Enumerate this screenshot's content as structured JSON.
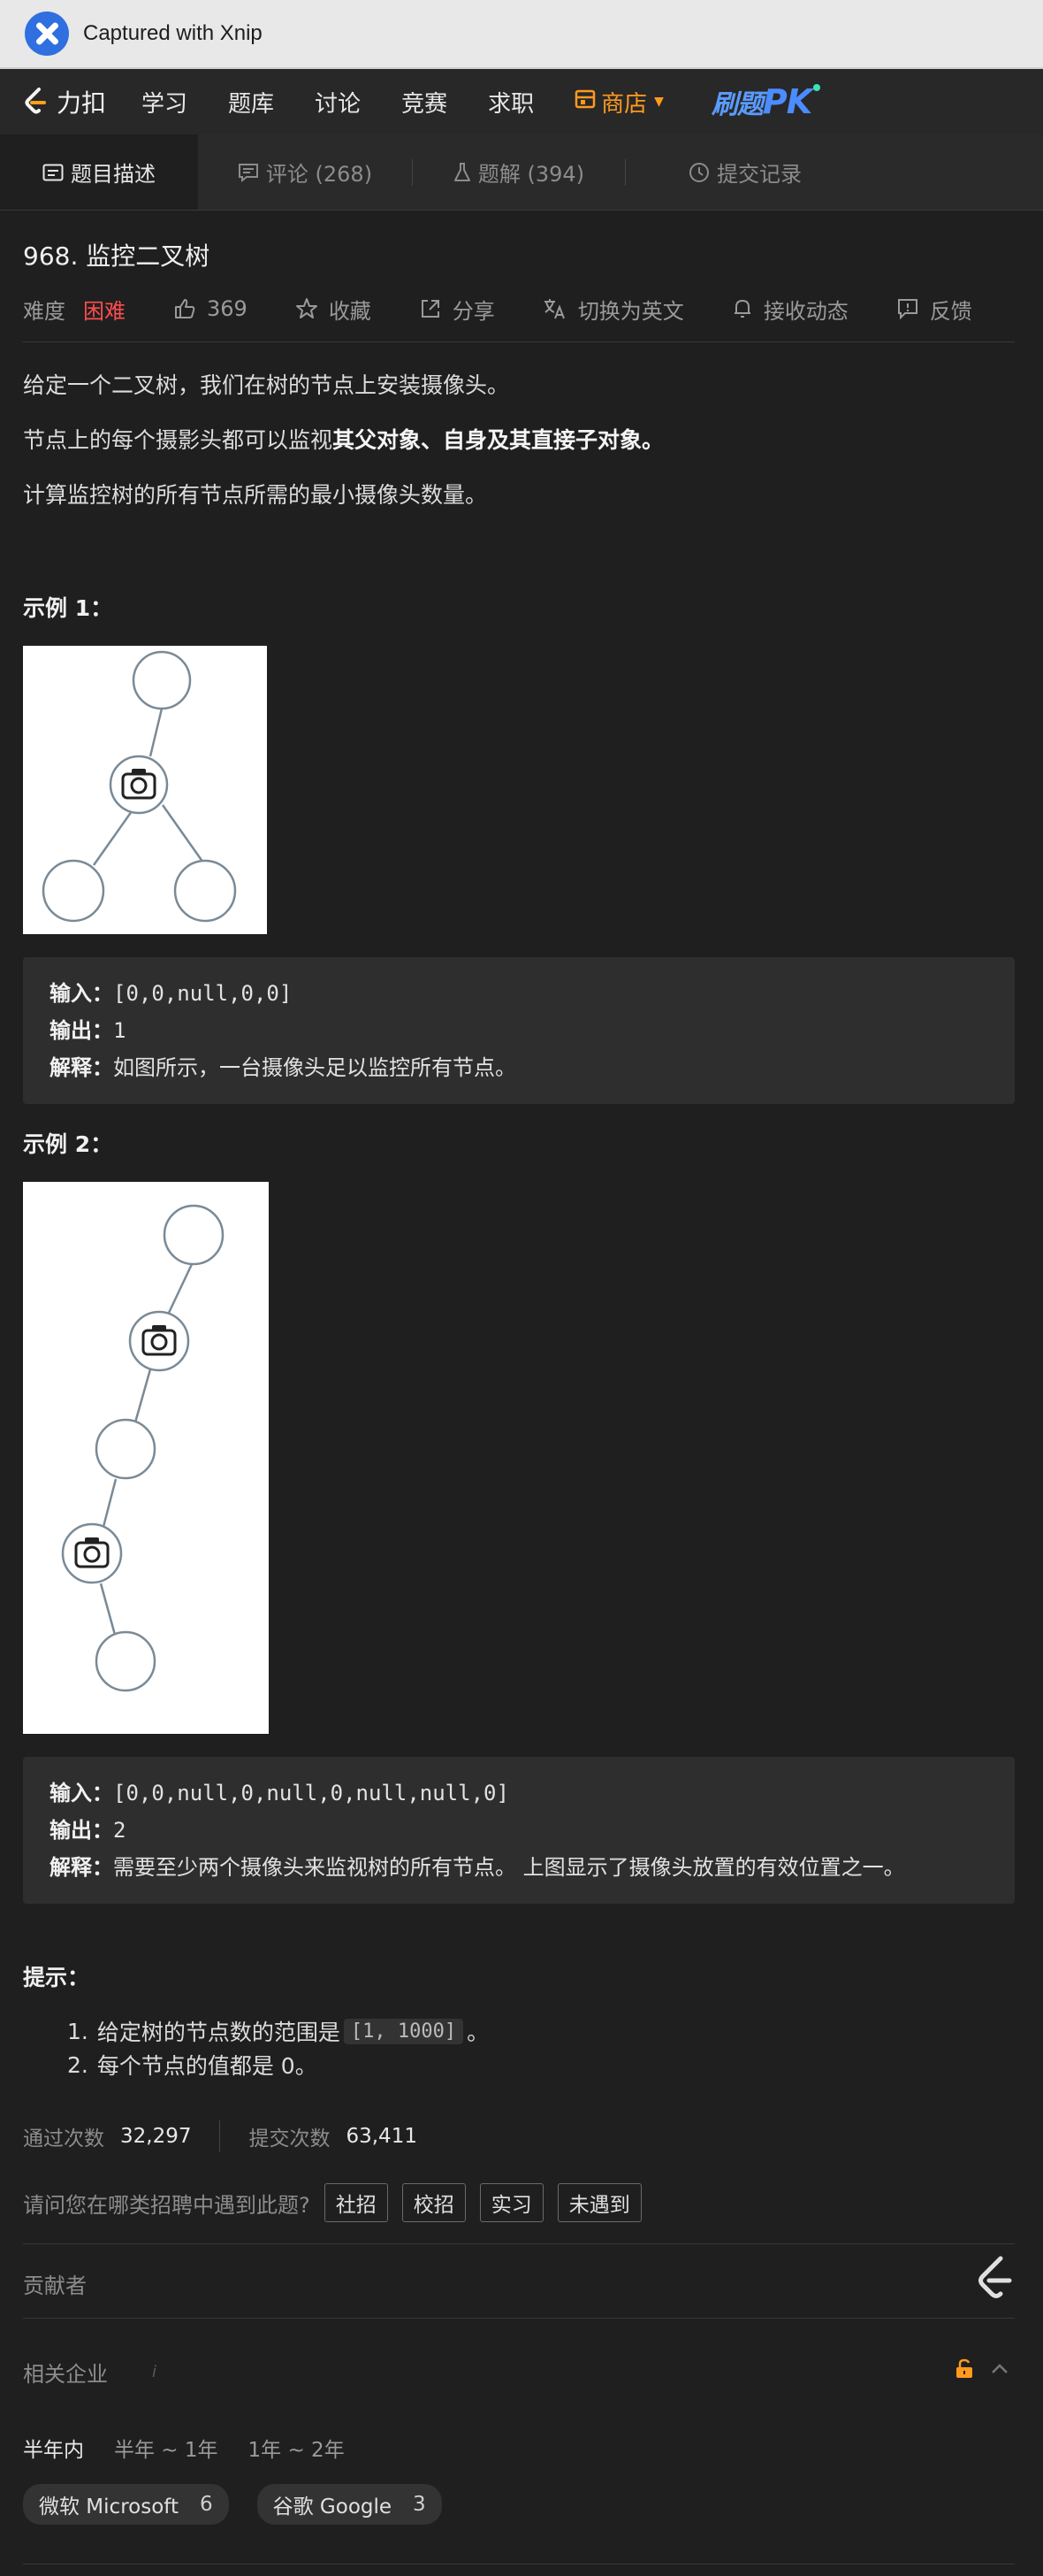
{
  "titlebar": {
    "text": "Captured with Xnip"
  },
  "nav": {
    "brand": "力扣",
    "items": [
      "学习",
      "题库",
      "讨论",
      "竞赛",
      "求职"
    ],
    "store": "商店",
    "pk_main": "刷题",
    "pk_tail": "PK"
  },
  "tabs": [
    {
      "label": "题目描述"
    },
    {
      "label": "评论 (268)"
    },
    {
      "label": "题解 (394)"
    },
    {
      "label": "提交记录"
    }
  ],
  "problem": {
    "title": "968. 监控二叉树",
    "difficulty_label": "难度",
    "difficulty": "困难",
    "likes": "369",
    "favorite": "收藏",
    "share": "分享",
    "switch_lang": "切换为英文",
    "subscribe": "接收动态",
    "feedback": "反馈",
    "p1": "给定一个二叉树，我们在树的节点上安装摄像头。",
    "p2_a": "节点上的每个摄影头都可以监视",
    "p2_b": "其父对象、自身及其直接子对象。",
    "p3": "计算监控树的所有节点所需的最小摄像头数量。"
  },
  "example1": {
    "title": "示例 1：",
    "input_label": "输入：",
    "input": "[0,0,null,0,0]",
    "output_label": "输出：",
    "output": "1",
    "explain_label": "解释：",
    "explain": "如图所示，一台摄像头足以监控所有节点。"
  },
  "example2": {
    "title": "示例 2：",
    "input_label": "输入：",
    "input": "[0,0,null,0,null,0,null,null,0]",
    "output_label": "输出：",
    "output": "2",
    "explain_label": "解释：",
    "explain": "需要至少两个摄像头来监视树的所有节点。 上图显示了摄像头放置的有效位置之一。"
  },
  "hints": {
    "title": "提示：",
    "h1_num": "1.",
    "h1_a": "给定树的节点数的范围是",
    "h1_code": "[1, 1000]",
    "h1_b": "。",
    "h2_num": "2.",
    "h2": "每个节点的值都是 0。"
  },
  "stats": {
    "passed_label": "通过次数",
    "passed": "32,297",
    "submitted_label": "提交次数",
    "submitted": "63,411"
  },
  "recruit": {
    "question": "请问您在哪类招聘中遇到此题?",
    "tags": [
      "社招",
      "校招",
      "实习",
      "未遇到"
    ]
  },
  "contributors_label": "贡献者",
  "companies": {
    "label": "相关企业",
    "periods": [
      "半年内",
      "半年 ~ 1年",
      "1年 ~ 2年"
    ],
    "list": [
      {
        "name": "微软 Microsoft",
        "count": "6"
      },
      {
        "name": "谷歌 Google",
        "count": "3"
      }
    ]
  },
  "colors": {
    "accent_store": "#ff9a1f",
    "difficulty_hard": "#ff4d4f",
    "pk_blue": "#4b8cff"
  }
}
